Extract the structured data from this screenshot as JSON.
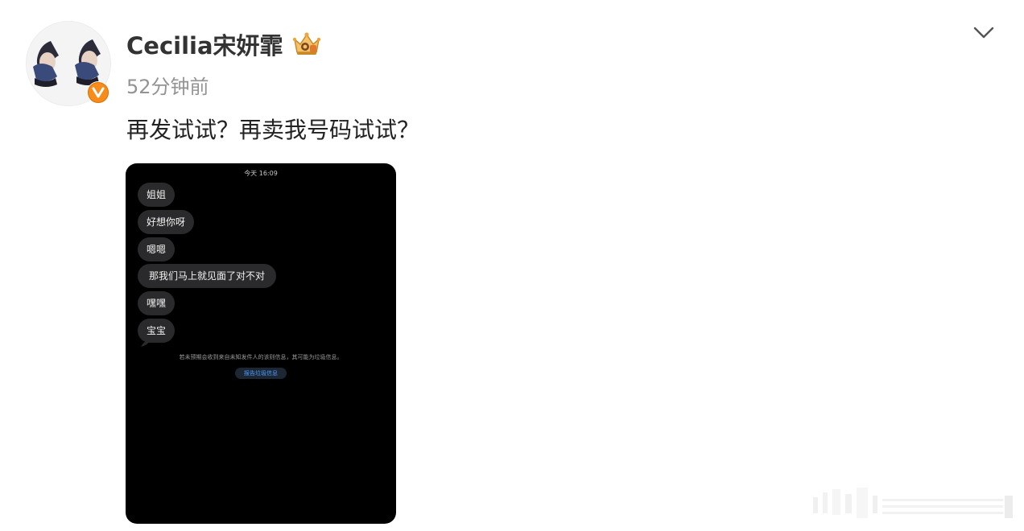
{
  "post": {
    "username": "Cecilia宋妍霏",
    "timestamp": "52分钟前",
    "caption": "再发试试？再卖我号码试试？"
  },
  "icons": {
    "avatar": "avatar-photo",
    "verified": "verified-v-badge-icon",
    "crown": "crown-level-icon",
    "chevron": "chevron-down-icon"
  },
  "colors": {
    "verified_badge": "#f78c1b",
    "username": "#333333",
    "timestamp": "#939393",
    "caption": "#222222",
    "bubble": "#2a2a2c",
    "link": "#4b9bff"
  },
  "image": {
    "date": "今天 16:09",
    "messages": [
      "姐姐",
      "好想你呀",
      "嗯嗯",
      "那我们马上就见面了对不对",
      "嘿嘿",
      "宝宝"
    ],
    "notice": "若未预期会收到来自未知发件人的该则信息，其可能为垃圾信息。",
    "report_label": "报告垃圾信息"
  }
}
